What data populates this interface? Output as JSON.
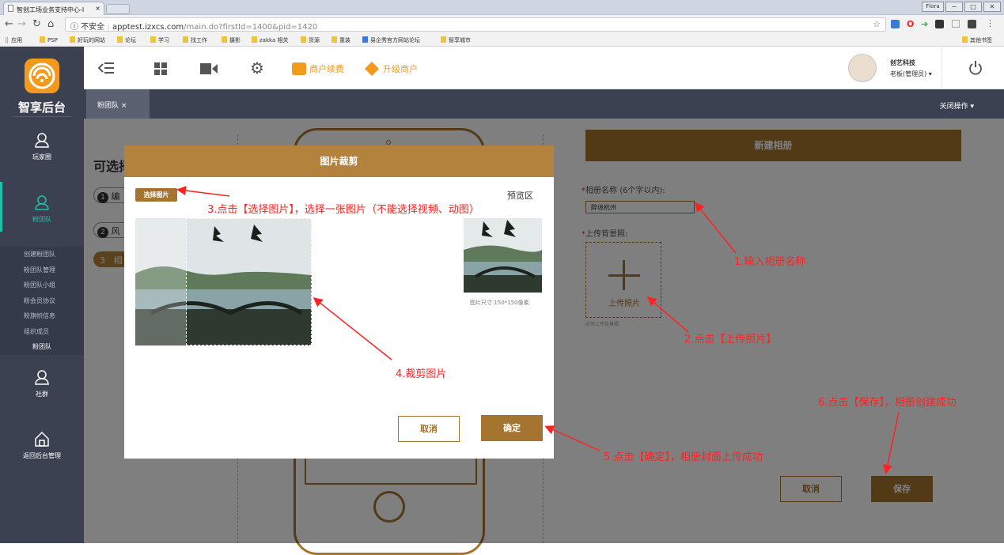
{
  "browser": {
    "tab_title": "智创工场业务支持中心-I",
    "tab_close": "×",
    "window_user": "Flora",
    "window_min": "−",
    "window_max": "□",
    "window_close": "✕",
    "insecure_label": "不安全",
    "url_host": "apptest.izxcs.com",
    "url_path": "/main.do?firstId=1400&pid=1420",
    "bookmarks": [
      "应用",
      "PSP",
      "好玩的网站",
      "论坛",
      "学习",
      "找工作",
      "摄影",
      "zakka 相关",
      "货源",
      "童装",
      "易企秀官方网站论坛",
      "智享城市"
    ],
    "other_bookmarks": "其他书签"
  },
  "sidebar": {
    "logo_text": "智享后台",
    "items": [
      {
        "label": "玩家圈"
      },
      {
        "label": "粉团队"
      },
      {
        "label": "社群"
      },
      {
        "label": "返回后台管理"
      }
    ],
    "sub_items": [
      "创建粉团队",
      "粉团队管理",
      "粉团队小组",
      "粉会员协议",
      "粉旗帜信息",
      "组织成员",
      "粉团队"
    ]
  },
  "header": {
    "renew_label": "商户续费",
    "upgrade_label": "升级商户",
    "company": "创艺科技",
    "user_role": "老板(管理员)",
    "caret": "▾"
  },
  "tabs": {
    "active": "粉团队 ×",
    "close_ops": "关闭操作"
  },
  "main": {
    "title_partial": "可选择",
    "steps": [
      {
        "num": "1",
        "text": "编"
      },
      {
        "num": "2",
        "text": "风"
      },
      {
        "num": "3",
        "text": "相"
      }
    ],
    "panel_title": "新建相册",
    "album_name_label": "相册名称",
    "album_name_hint": "(6个字以内):",
    "album_name_value": "醉迷杭州",
    "required_mark": "*",
    "bg_label": "上传背景照:",
    "upload_label": "上传照片",
    "upload_required": "必须上传背景照",
    "cancel": "取消",
    "save": "保存"
  },
  "dialog": {
    "title": "图片裁剪",
    "select_image": "选择图片",
    "preview_label": "预览区",
    "size_note": "图片尺寸:150*150像素",
    "cancel": "取消",
    "confirm": "确定"
  },
  "annotations": {
    "a1": "1.输入相册名称",
    "a2": "2.点击【上传照片】",
    "a3": "3.点击【选择图片】，选择一张图片（不能选择视频、动图）",
    "a4": "4.裁剪图片",
    "a5": "5.点击【确定】，相册封面上传成功",
    "a6": "6.点击【保存】，相册创建成功"
  },
  "colors": {
    "accent": "#a5742e",
    "sidebar": "#3c4152",
    "annotation": "#ff2222",
    "orange": "#f39a1c"
  }
}
